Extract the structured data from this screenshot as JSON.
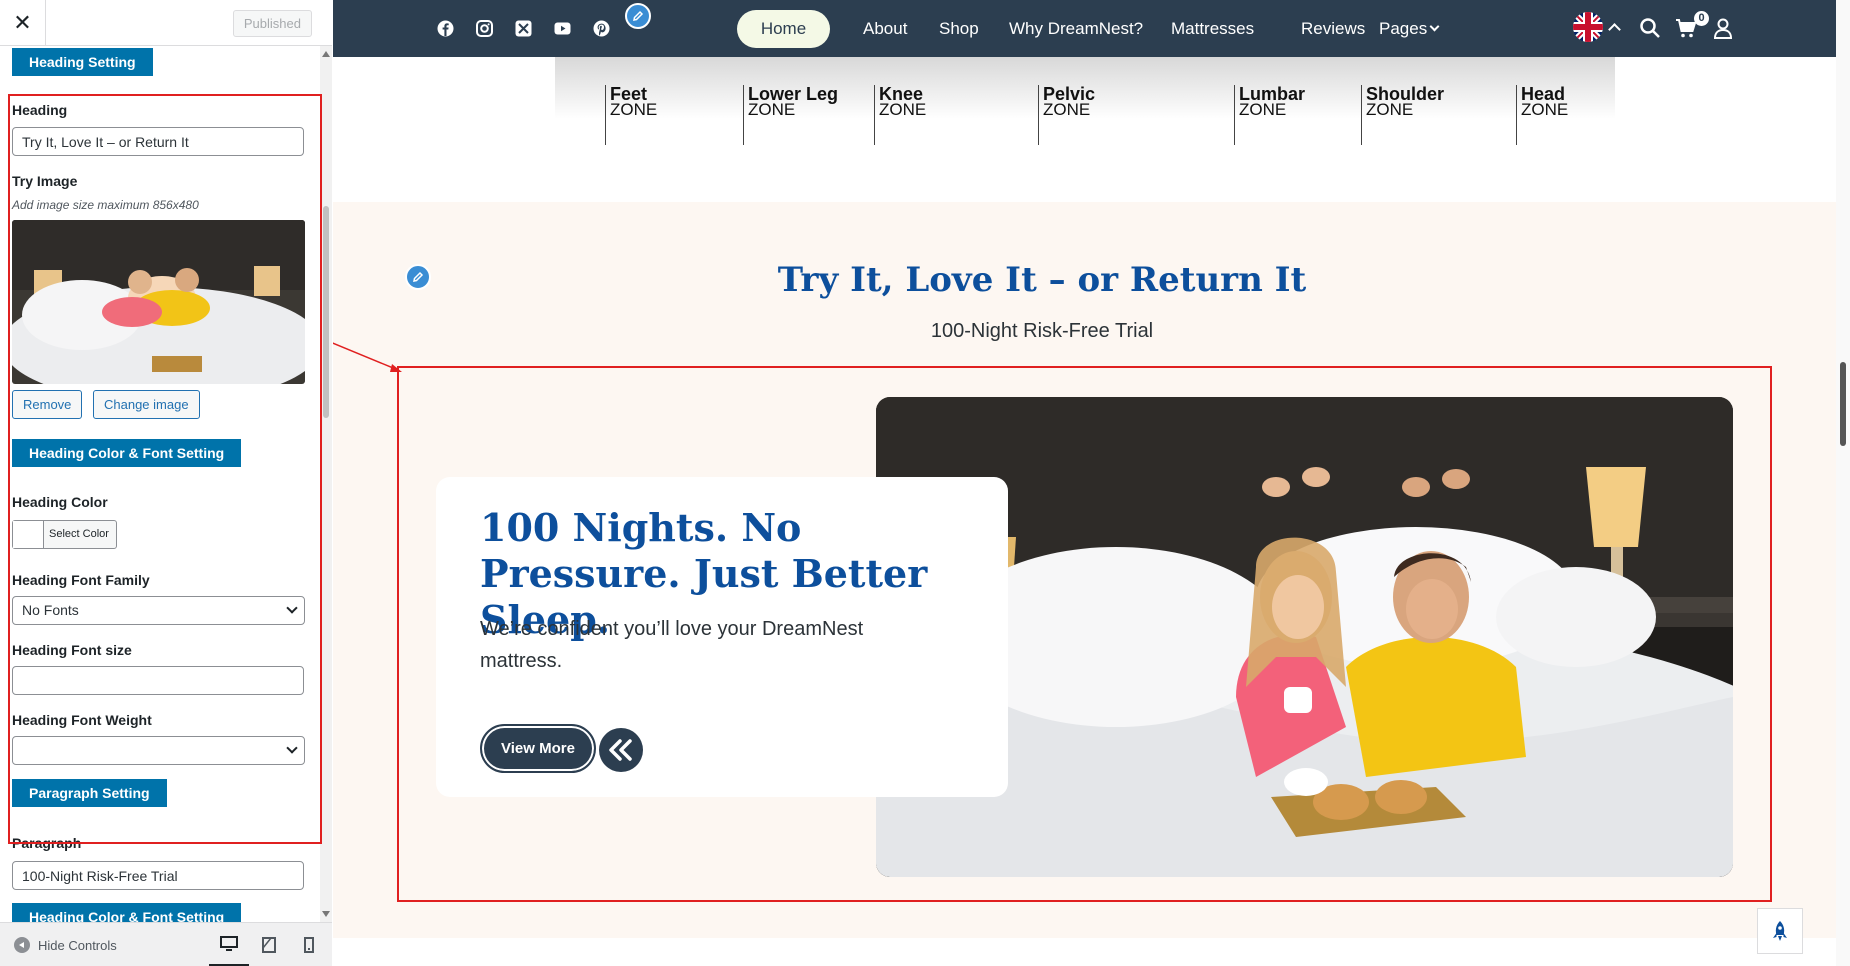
{
  "sidebar": {
    "close_label": "✕",
    "publish_label": "Published",
    "heading_setting_label": "Heading Setting",
    "heading_label": "Heading",
    "heading_value": "Try It, Love It – or Return It",
    "try_image_label": "Try Image",
    "try_image_hint": "Add image size maximum 856x480",
    "remove_label": "Remove",
    "change_image_label": "Change image",
    "heading_color_font_label": "Heading Color & Font Setting",
    "heading_color_label": "Heading Color",
    "select_color_label": "Select Color",
    "heading_font_family_label": "Heading Font Family",
    "heading_font_family_value": "No Fonts",
    "heading_font_size_label": "Heading Font size",
    "heading_font_size_value": "",
    "heading_font_weight_label": "Heading Font Weight",
    "heading_font_weight_value": "",
    "paragraph_setting_label": "Paragraph Setting",
    "paragraph_label": "Paragraph",
    "paragraph_value": "100-Night Risk-Free Trial",
    "paragraph_color_font_label": "Heading Color & Font Setting",
    "hide_controls_label": "Hide Controls"
  },
  "navbar": {
    "social_icons": [
      "facebook-icon",
      "instagram-icon",
      "x-icon",
      "youtube-icon",
      "pinterest-icon"
    ],
    "home": "Home",
    "about": "About",
    "shop": "Shop",
    "why": "Why DreamNest?",
    "mattresses": "Mattresses",
    "reviews": "Reviews",
    "pages": "Pages",
    "cart_count": "0"
  },
  "zones": [
    {
      "name": "Feet",
      "sub": "ZONE"
    },
    {
      "name": "Lower Leg",
      "sub": "ZONE"
    },
    {
      "name": "Knee",
      "sub": "ZONE"
    },
    {
      "name": "Pelvic",
      "sub": "ZONE"
    },
    {
      "name": "Lumbar",
      "sub": "ZONE"
    },
    {
      "name": "Shoulder",
      "sub": "ZONE"
    },
    {
      "name": "Head",
      "sub": "ZONE"
    }
  ],
  "trial": {
    "heading": "Try It, Love It – or Return It",
    "subheading": "100-Night Risk-Free Trial",
    "card_title": "100 Nights. No Pressure. Just Better Sleep.",
    "card_text": "We’re confident you’ll love your DreamNest mattress.",
    "button_label": "View More"
  },
  "colors": {
    "navbar": "#2c3e50",
    "accent_blue": "#0d4f9c",
    "wp_blue": "#0073aa",
    "highlight_red": "#e02020",
    "section_bg": "#fdf7f2"
  }
}
